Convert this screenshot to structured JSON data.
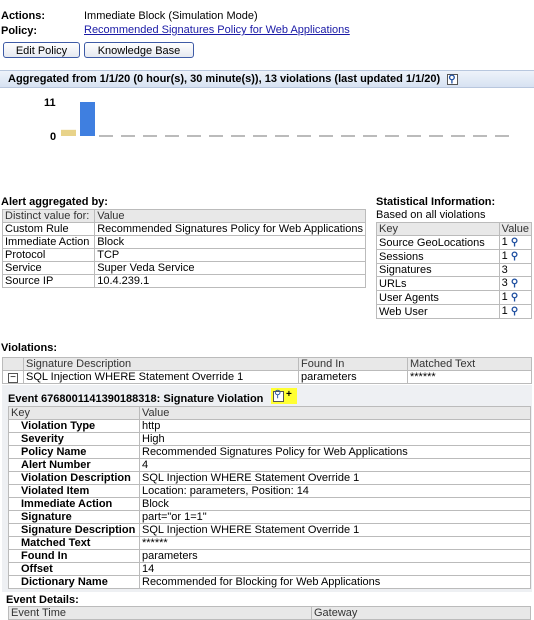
{
  "header": {
    "actions_label": "Actions:",
    "actions_value": "Immediate Block (Simulation Mode)",
    "policy_label": "Policy:",
    "policy_link": "Recommended Signatures Policy for Web Applications",
    "edit_policy_button": "Edit Policy",
    "knowledge_base_button": "Knowledge Base"
  },
  "aggregated": {
    "text": "Aggregated from  1/1/20 (0 hour(s), 30 minute(s)), 13 violations (last updated 1/1/20)"
  },
  "chart_data": {
    "type": "bar",
    "yticks": [
      "11",
      "0"
    ],
    "series": [
      {
        "color": "#e8d38a",
        "values": [
          2
        ]
      },
      {
        "color": "#3f7fe0",
        "values": [
          11
        ]
      }
    ],
    "empty_slots": 19
  },
  "alert_aggregated": {
    "title": "Alert aggregated by:",
    "headers": [
      "Distinct value for:",
      "Value"
    ],
    "rows": [
      [
        "Custom Rule",
        "Recommended Signatures Policy for Web Applications"
      ],
      [
        "Immediate Action",
        "Block"
      ],
      [
        "Protocol",
        "TCP"
      ],
      [
        "Service",
        "Super Veda Service"
      ],
      [
        "Source IP",
        "10.4.239.1"
      ]
    ]
  },
  "statistical": {
    "title": "Statistical Information:",
    "subtitle": "Based on all violations",
    "headers": [
      "Key",
      "Value"
    ],
    "rows": [
      [
        "Source GeoLocations",
        "1"
      ],
      [
        "Sessions",
        "1"
      ],
      [
        "Signatures",
        "3"
      ],
      [
        "URLs",
        "3"
      ],
      [
        "User Agents",
        "1"
      ],
      [
        "Web User",
        "1"
      ]
    ]
  },
  "violations": {
    "title": "Violations:",
    "headers": [
      "Signature Description",
      "Found In",
      "Matched Text"
    ],
    "row": [
      "SQL Injection WHERE Statement Override 1",
      "parameters",
      "******"
    ],
    "expand_symbol": "−"
  },
  "event": {
    "title": "Event  6768001141390188318:  Signature Violation",
    "headers": [
      "Key",
      "Value"
    ],
    "rows": [
      [
        "Violation Type",
        "http"
      ],
      [
        "Severity",
        "High"
      ],
      [
        "Policy Name",
        "Recommended Signatures Policy for Web Applications"
      ],
      [
        "Alert Number",
        "4"
      ],
      [
        "Violation Description",
        "SQL Injection WHERE Statement Override 1"
      ],
      [
        "Violated Item",
        "Location: parameters, Position: 14"
      ],
      [
        "Immediate Action",
        "Block"
      ],
      [
        "Signature",
        "part=\"or 1=1\""
      ],
      [
        "Signature Description",
        "SQL Injection WHERE Statement Override 1"
      ],
      [
        "Matched Text",
        "******"
      ],
      [
        "Found In",
        "parameters"
      ],
      [
        "Offset",
        "14"
      ],
      [
        "Dictionary Name",
        "Recommended for Blocking for Web Applications"
      ]
    ]
  },
  "event_details": {
    "title": "Event Details:",
    "headers": [
      "Event Time",
      "Gateway"
    ]
  },
  "colors": {
    "link": "#1a1aa6",
    "highlight": "#ffff33",
    "bar_blue": "#3f7fe0",
    "bar_yellow": "#e8d38a"
  }
}
